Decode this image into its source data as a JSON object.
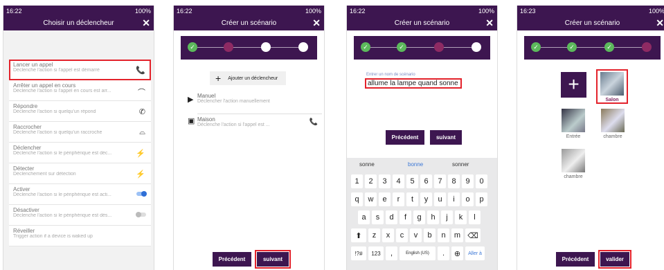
{
  "screens": [
    {
      "status": {
        "time": "16:22",
        "right": "100%"
      },
      "title": "Choisir un déclencheur",
      "close": "✕",
      "triggers": [
        {
          "title": "Lancer un appel",
          "desc": "Déclenche l'action si l'appel est démarré",
          "icon": "📞",
          "selected": true
        },
        {
          "title": "Arrêter un appel en cours",
          "desc": "Déclenche l'action si l'appel en cours est arr...",
          "icon": "⌒"
        },
        {
          "title": "Répondre",
          "desc": "Déclenche l'action si quelqu'un répond",
          "icon": "✆"
        },
        {
          "title": "Raccrocher",
          "desc": "Déclenche l'action si quelqu'un raccroche",
          "icon": "⌓"
        },
        {
          "title": "Déclencher",
          "desc": "Déclenche l'action si le périphérique est déc...",
          "icon": "⚡"
        },
        {
          "title": "Détecter",
          "desc": "Déclenchement sur détection",
          "icon": "⚡"
        },
        {
          "title": "Activer",
          "desc": "Déclenche l'action si le périphérique est acti...",
          "toggle": "on"
        },
        {
          "title": "Désactiver",
          "desc": "Déclenche l'action si le périphérique est dés...",
          "toggle": "off"
        },
        {
          "title": "Réveiller",
          "desc": "Trigger action if a device is waked up"
        }
      ]
    },
    {
      "status": {
        "time": "16:22",
        "right": "100%"
      },
      "title": "Créer un scénario",
      "close": "✕",
      "add_trigger": "Ajouter un déclencheur",
      "items": [
        {
          "title": "Manuel",
          "desc": "Déclencher l'action manuellement",
          "icon": "▶"
        },
        {
          "title": "Maison",
          "desc": "Déclenche l'action si l'appel est ...",
          "icon": "▣",
          "right_icon": "📞"
        }
      ],
      "prev": "Précédent",
      "next": "suivant"
    },
    {
      "status": {
        "time": "16:22",
        "right": "100%"
      },
      "title": "Créer un scénario",
      "close": "✕",
      "field_label": "Entrer un nom de scénario",
      "field_value": "allume la lampe quand sonne",
      "prev": "Précédent",
      "next": "suivant",
      "suggestions": [
        "sonne",
        "bonne",
        "sonner"
      ],
      "keys_row1": [
        "1",
        "2",
        "3",
        "4",
        "5",
        "6",
        "7",
        "8",
        "9",
        "0"
      ],
      "keys_row2": [
        "q",
        "w",
        "e",
        "r",
        "t",
        "y",
        "u",
        "i",
        "o",
        "p"
      ],
      "keys_row3": [
        "a",
        "s",
        "d",
        "f",
        "g",
        "h",
        "j",
        "k",
        "l"
      ],
      "keys_row4": [
        "z",
        "x",
        "c",
        "v",
        "b",
        "n",
        "m"
      ],
      "bottom": {
        "sym": "!?#",
        "num": "123",
        "comma": ",",
        "space": "English (US)",
        "period": ".",
        "go": "Aller à"
      }
    },
    {
      "status": {
        "time": "16:23",
        "right": "100%"
      },
      "title": "Créer un scénario",
      "close": "✕",
      "rooms": [
        {
          "name": "Salon",
          "selected": true
        },
        {
          "name": "Entrée"
        },
        {
          "name": "chambre"
        },
        {
          "name": "chambre"
        }
      ],
      "prev": "Précédent",
      "validate": "valider"
    }
  ],
  "colors": {
    "primary": "#3d1650",
    "highlight": "#e3222b",
    "done": "#5cb85c",
    "pending": "#8e2a63"
  }
}
